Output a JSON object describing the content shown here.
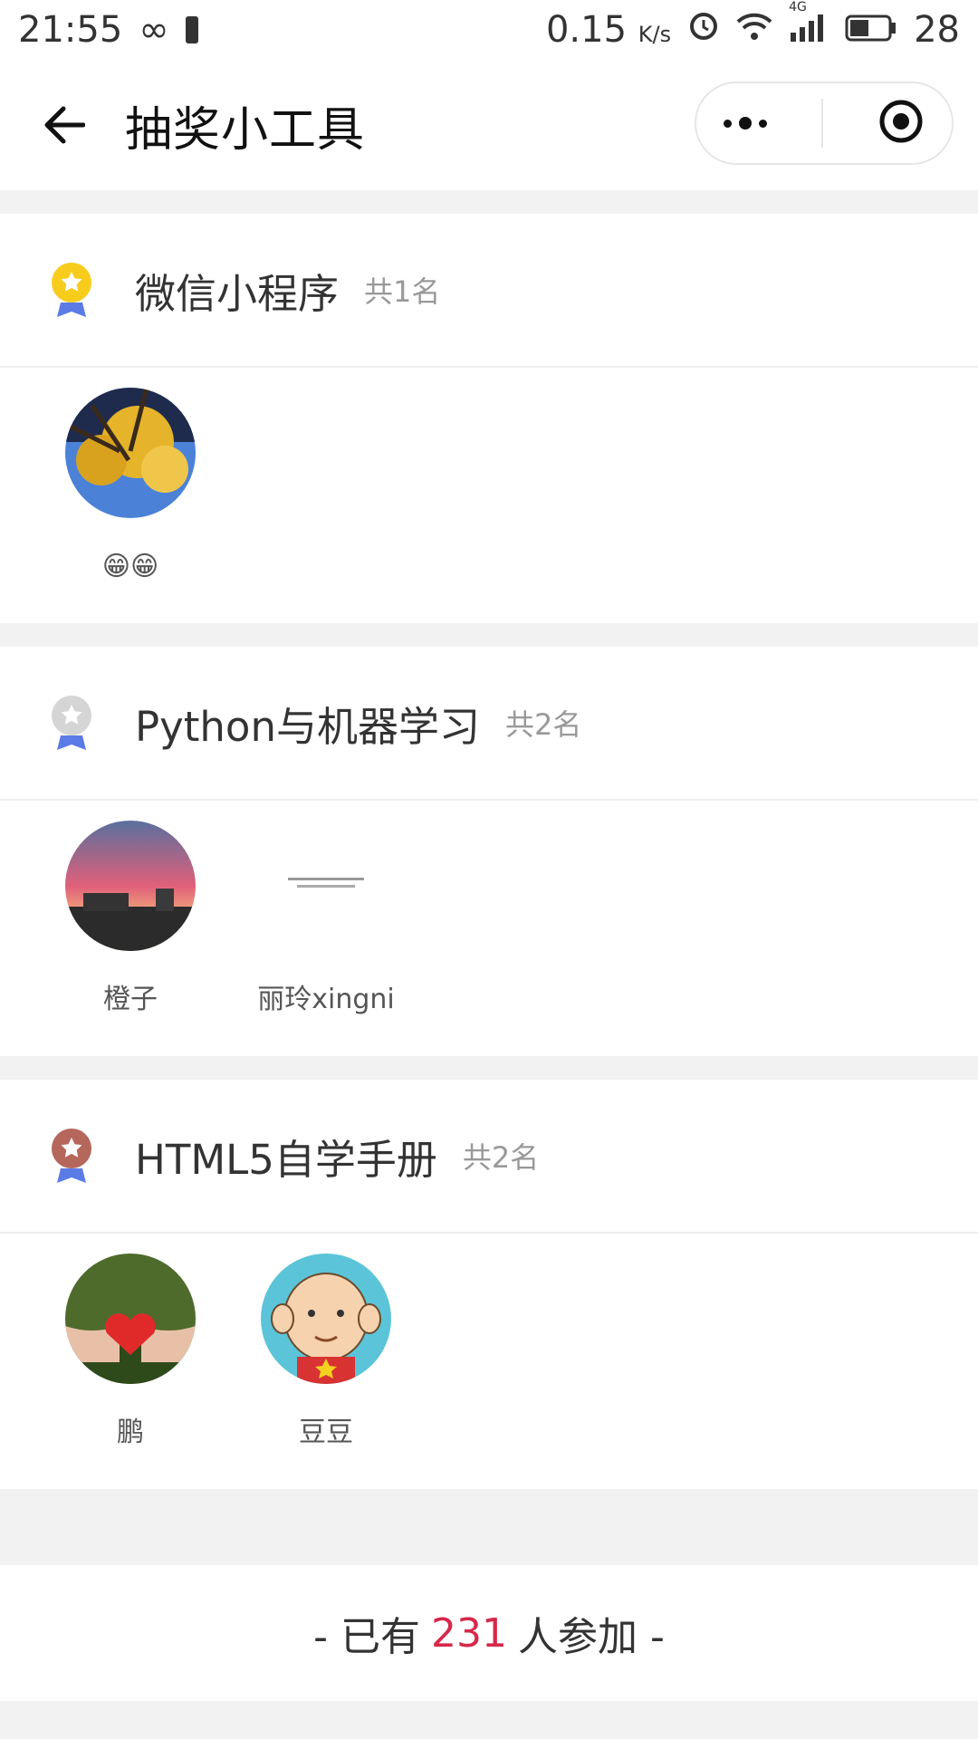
{
  "status_bar": {
    "time": "21:55",
    "speed": "0.15",
    "speed_unit": "K/s",
    "battery": "28",
    "network": "4G"
  },
  "nav": {
    "title": "抽奖小工具"
  },
  "prizes": [
    {
      "name": "微信小程序",
      "count": "共1名",
      "medal": "gold",
      "winners": [
        {
          "name": "😁😁",
          "avatar": "ginkgo-tree-avatar"
        }
      ]
    },
    {
      "name": "Python与机器学习",
      "count": "共2名",
      "medal": "silver",
      "winners": [
        {
          "name": "橙子",
          "avatar": "sunset-sky-avatar"
        },
        {
          "name": "丽玲xingni",
          "avatar": "text-image-avatar"
        }
      ]
    },
    {
      "name": "HTML5自学手册",
      "count": "共2名",
      "medal": "bronze",
      "winners": [
        {
          "name": "鹏",
          "avatar": "paper-heart-avatar"
        },
        {
          "name": "豆豆",
          "avatar": "cartoon-boy-avatar"
        }
      ]
    }
  ],
  "footer": {
    "prefix": "- 已有",
    "count": "231",
    "suffix": "人参加 -"
  },
  "colors": {
    "accent": "#d6284a",
    "gold": "#f7cc1d",
    "silver": "#d5d5d5",
    "bronze": "#b5675b",
    "ribbon": "#5b7be6"
  }
}
